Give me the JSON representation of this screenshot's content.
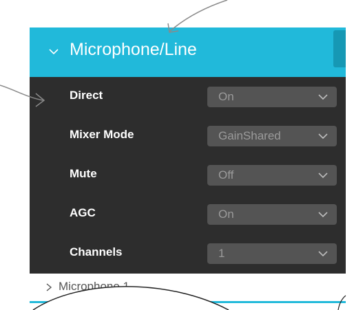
{
  "colors": {
    "accent": "#21b9da",
    "panel_background": "#2d2d2d",
    "select_background": "#545454",
    "select_text": "#9b9b9b"
  },
  "header": {
    "title": "Microphone/Line",
    "icon": "chevron-down-icon"
  },
  "settings": [
    {
      "label": "Direct",
      "value": "On"
    },
    {
      "label": "Mixer Mode",
      "value": "GainShared"
    },
    {
      "label": "Mute",
      "value": "Off"
    },
    {
      "label": "AGC",
      "value": "On"
    },
    {
      "label": "Channels",
      "value": "1"
    }
  ],
  "sub_item": {
    "label": "Microphone 1",
    "icon": "chevron-right-icon"
  }
}
